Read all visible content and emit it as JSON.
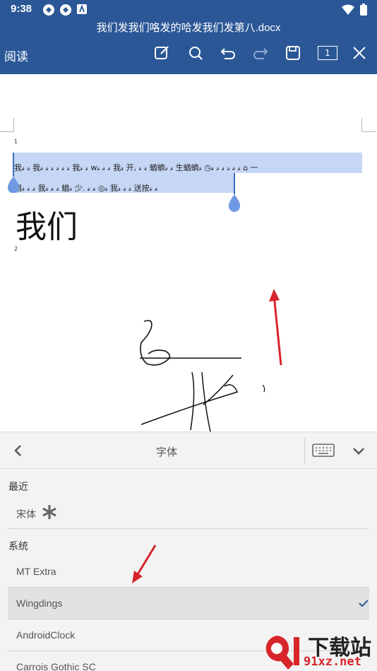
{
  "status_bar": {
    "time": "9:38",
    "icons": [
      "sync-icon",
      "sync-icon",
      "notification-icon",
      "wifi-icon",
      "battery-icon"
    ]
  },
  "header": {
    "title": "我们发我们咯发的哈发我们发第八.docx",
    "mode": "阅读",
    "page_indicator": "1",
    "colors": {
      "app_bar": "#2b5797",
      "icon": "#ffffff"
    }
  },
  "document": {
    "page_numbers": [
      "1",
      "2"
    ],
    "line1": "我𝓈  𝓈 我𝓈  𝓈 𝓈 𝓈 𝓈 𝓈  我𝓈  𝓈 ᴡ𝓈 𝓈 𝓈  我𝓈  开,  𝓈 𝓈  蝤蠐𝓈 𝓈  生蝤蠐𝓈 ◷𝓈 𝓈 𝓈 𝓈 𝓈 𝓈  ⌂ 一",
    "line2": "蝤𝓈 𝓈 𝓈  我𝓈  𝓈 𝓈  蝤𝓈 少.  𝓈 𝓈 ◎𝓈 我𝓈  𝓈 𝓈 送按𝓈 𝓈",
    "big_text": "我们",
    "selection_color": "#c6d6f5"
  },
  "font_panel": {
    "title": "字体",
    "sections": {
      "recent": "最近",
      "system": "系统"
    },
    "recent_fonts": [
      {
        "name": "宋体"
      }
    ],
    "system_fonts": [
      {
        "name": "MT Extra",
        "selected": false
      },
      {
        "name": "Wingdings",
        "selected": true
      },
      {
        "name": "AndroidClock",
        "selected": false
      },
      {
        "name": "Carrois Gothic SC",
        "selected": false
      }
    ],
    "colors": {
      "check": "#2b5797",
      "selected_bg": "#e2e2e2"
    }
  },
  "watermark": {
    "logo_text": "下载站",
    "url": "91xz.net"
  }
}
